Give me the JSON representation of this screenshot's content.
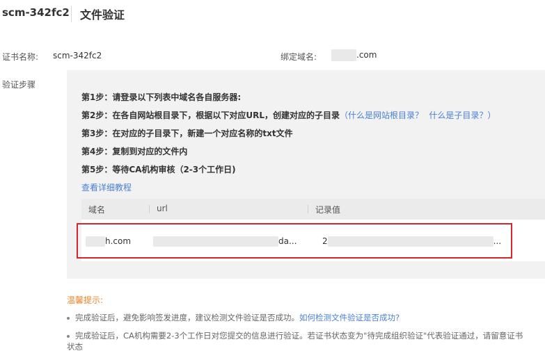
{
  "header": {
    "cert_id": "scm-342fc2",
    "title": "文件验证"
  },
  "info": {
    "cert_name_label": "证书名称:",
    "cert_name_value": "scm-342fc2",
    "domain_label": "绑定域名:",
    "domain_suffix": ".com",
    "steps_label": "验证步骤"
  },
  "steps": {
    "step1": "第1步：请登录以下列表中域名各自服务器:",
    "step2": "第2步：在各自网站根目录下，根据以下对应URL，创建对应的子目录",
    "step2_link_root": "（什么是网站根目录？",
    "step2_link_sub": "什么是子目录？）",
    "step3": "第3步：在对应的子目录下，新建一个对应名称的txt文件",
    "step4": "第4步：复制到对应的文件内",
    "step5": "第5步：等待CA机构审核（2-3个工作日)",
    "tutorial_link": "查看详细教程"
  },
  "table": {
    "columns": [
      "域名",
      "url",
      "记录值"
    ],
    "row": {
      "domain_suffix": "h.com",
      "url_suffix": "da...",
      "record_prefix": "2",
      "record_suffix": "..."
    }
  },
  "tips": {
    "title": "温馨提示:",
    "tip1": "完成验证后，避免影响签发进度，建议检测文件验证是否成功。",
    "tip1_link": "如何检测文件验证是否成功?",
    "tip2_line1": "完成验证后，CA机构需要2-3个工作日对您提交的信息进行验证。若证书状态变为\"待完成组织验证\"代表验证通过，请留意证书",
    "tip2_line2": "状态"
  },
  "colors": {
    "link": "#4a7fd6",
    "tips_title": "#f0862b",
    "highlight": "#d9232d",
    "panel_bg": "#f2f2f2"
  }
}
